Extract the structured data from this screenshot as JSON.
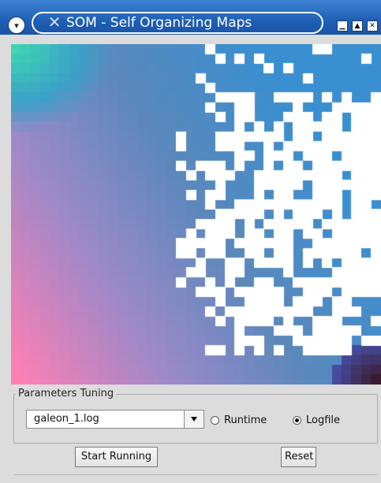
{
  "window": {
    "title": "SOM - Self Organizing Maps",
    "icons": {
      "menu": "chevron-down-icon",
      "app": "x-logo-icon",
      "minimize": "minimize-icon",
      "maximize": "maximize-icon",
      "close": "close-icon"
    }
  },
  "map": {
    "grid_cols": 38,
    "grid_rows": 35,
    "colors": {
      "pink": "#ff7fb4",
      "lavender": "#9b89c9",
      "steel_blue": "#5b88bb",
      "bright_blue": "#3a8fd0",
      "teal": "#3aa0c8",
      "mint": "#3fd6b2",
      "dark": "#3a1a2c",
      "cell_gap": "#ffffff"
    }
  },
  "params": {
    "group_title": "Parameters Tuning",
    "file_combo_value": "galeon_1.log",
    "radio_runtime_label": "Runtime",
    "radio_logfile_label": "Logfile",
    "selected_mode": "Logfile",
    "start_button_label": "Start Running",
    "reset_button_label": "Reset"
  }
}
